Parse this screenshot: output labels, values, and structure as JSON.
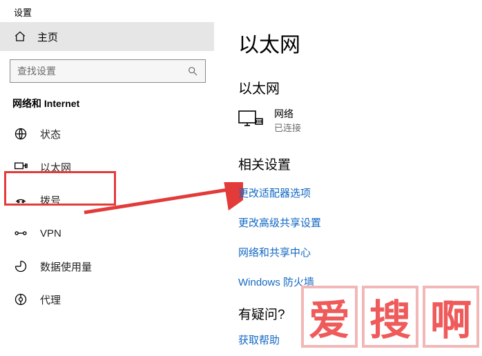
{
  "window": {
    "title": "设置"
  },
  "sidebar": {
    "home": "主页",
    "search_placeholder": "查找设置",
    "section": "网络和 Internet",
    "items": [
      {
        "label": "状态"
      },
      {
        "label": "以太网"
      },
      {
        "label": "拨号"
      },
      {
        "label": "VPN"
      },
      {
        "label": "数据使用量"
      },
      {
        "label": "代理"
      }
    ]
  },
  "main": {
    "title": "以太网",
    "subheading": "以太网",
    "network": {
      "name": "网络",
      "status": "已连接"
    },
    "related_heading": "相关设置",
    "links": [
      "更改适配器选项",
      "更改高级共享设置",
      "网络和共享中心",
      "Windows 防火墙"
    ],
    "question_heading": "有疑问?",
    "help_link": "获取帮助"
  },
  "watermark": [
    "爱",
    "搜",
    "啊"
  ]
}
